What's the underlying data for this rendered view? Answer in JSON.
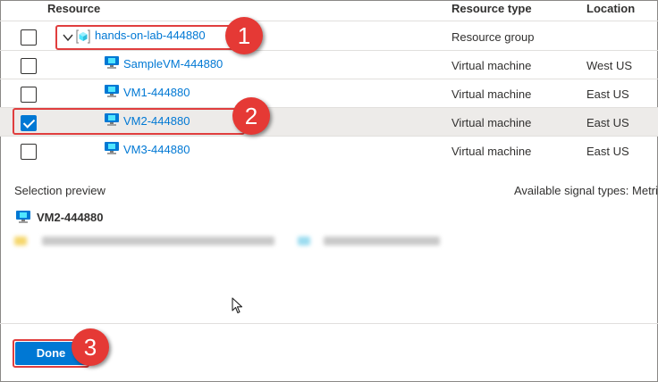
{
  "columns": {
    "resource": "Resource",
    "resource_type": "Resource type",
    "location": "Location"
  },
  "rows": [
    {
      "name": "hands-on-lab-444880",
      "type": "Resource group",
      "location": "",
      "checked": false,
      "icon": "resource-group-icon"
    },
    {
      "name": "SampleVM-444880",
      "type": "Virtual machine",
      "location": "West US",
      "checked": false,
      "icon": "virtual-machine-icon"
    },
    {
      "name": "VM1-444880",
      "type": "Virtual machine",
      "location": "East US",
      "checked": false,
      "icon": "virtual-machine-icon"
    },
    {
      "name": "VM2-444880",
      "type": "Virtual machine",
      "location": "East US",
      "checked": true,
      "icon": "virtual-machine-icon"
    },
    {
      "name": "VM3-444880",
      "type": "Virtual machine",
      "location": "East US",
      "checked": false,
      "icon": "virtual-machine-icon"
    }
  ],
  "preview": {
    "label": "Selection preview",
    "signal_types": "Available signal types: Metri",
    "selected_name": "VM2-444880"
  },
  "footer": {
    "done_label": "Done"
  },
  "callouts": [
    "1",
    "2",
    "3"
  ],
  "colors": {
    "accent": "#0078d4",
    "callout_red": "#e53935",
    "selected_row": "#edebe9"
  }
}
